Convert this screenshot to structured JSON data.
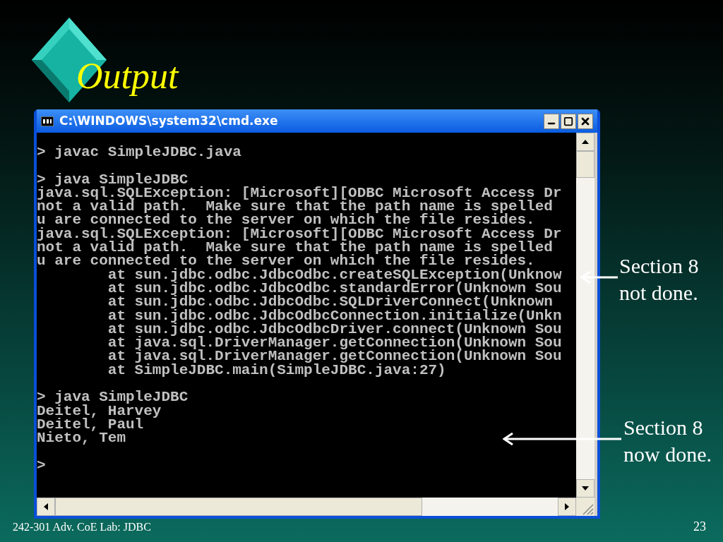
{
  "slide": {
    "title": "Output",
    "footer": "242-301 Adv. CoE Lab: JDBC",
    "page_number": "23"
  },
  "window": {
    "title": "C:\\WINDOWS\\system32\\cmd.exe",
    "console_lines": [
      {
        "kind": "text",
        "text": "> javac SimpleJDBC.java"
      },
      {
        "kind": "blank"
      },
      {
        "kind": "text",
        "text": "> java SimpleJDBC"
      },
      {
        "kind": "text",
        "text": "java.sql.SQLException: [Microsoft][ODBC Microsoft Access Dr"
      },
      {
        "kind": "text",
        "text": "not a valid path.  Make sure that the path name is spelled"
      },
      {
        "kind": "text",
        "text": "u are connected to the server on which the file resides."
      },
      {
        "kind": "text",
        "text": "java.sql.SQLException: [Microsoft][ODBC Microsoft Access Dr"
      },
      {
        "kind": "text",
        "text": "not a valid path.  Make sure that the path name is spelled"
      },
      {
        "kind": "text",
        "text": "u are connected to the server on which the file resides."
      },
      {
        "kind": "text",
        "text": "        at sun.jdbc.odbc.JdbcOdbc.createSQLException(Unknow"
      },
      {
        "kind": "text",
        "text": "        at sun.jdbc.odbc.JdbcOdbc.standardError(Unknown Sou"
      },
      {
        "kind": "text",
        "text": "        at sun.jdbc.odbc.JdbcOdbc.SQLDriverConnect(Unknown"
      },
      {
        "kind": "text",
        "text": "        at sun.jdbc.odbc.JdbcOdbcConnection.initialize(Unkn"
      },
      {
        "kind": "text",
        "text": "        at sun.jdbc.odbc.JdbcOdbcDriver.connect(Unknown Sou"
      },
      {
        "kind": "text",
        "text": "        at java.sql.DriverManager.getConnection(Unknown Sou"
      },
      {
        "kind": "text",
        "text": "        at java.sql.DriverManager.getConnection(Unknown Sou"
      },
      {
        "kind": "text",
        "text": "        at SimpleJDBC.main(SimpleJDBC.java:27)"
      },
      {
        "kind": "blank"
      },
      {
        "kind": "text",
        "text": "> java SimpleJDBC"
      },
      {
        "kind": "text",
        "text": "Deitel, Harvey"
      },
      {
        "kind": "text",
        "text": "Deitel, Paul"
      },
      {
        "kind": "text",
        "text": "Nieto, Tem"
      },
      {
        "kind": "blank"
      },
      {
        "kind": "text",
        "text": ">"
      }
    ]
  },
  "annotations": [
    {
      "lines": [
        "Section 8",
        "not done."
      ]
    },
    {
      "lines": [
        "Section 8",
        "now done."
      ]
    }
  ]
}
